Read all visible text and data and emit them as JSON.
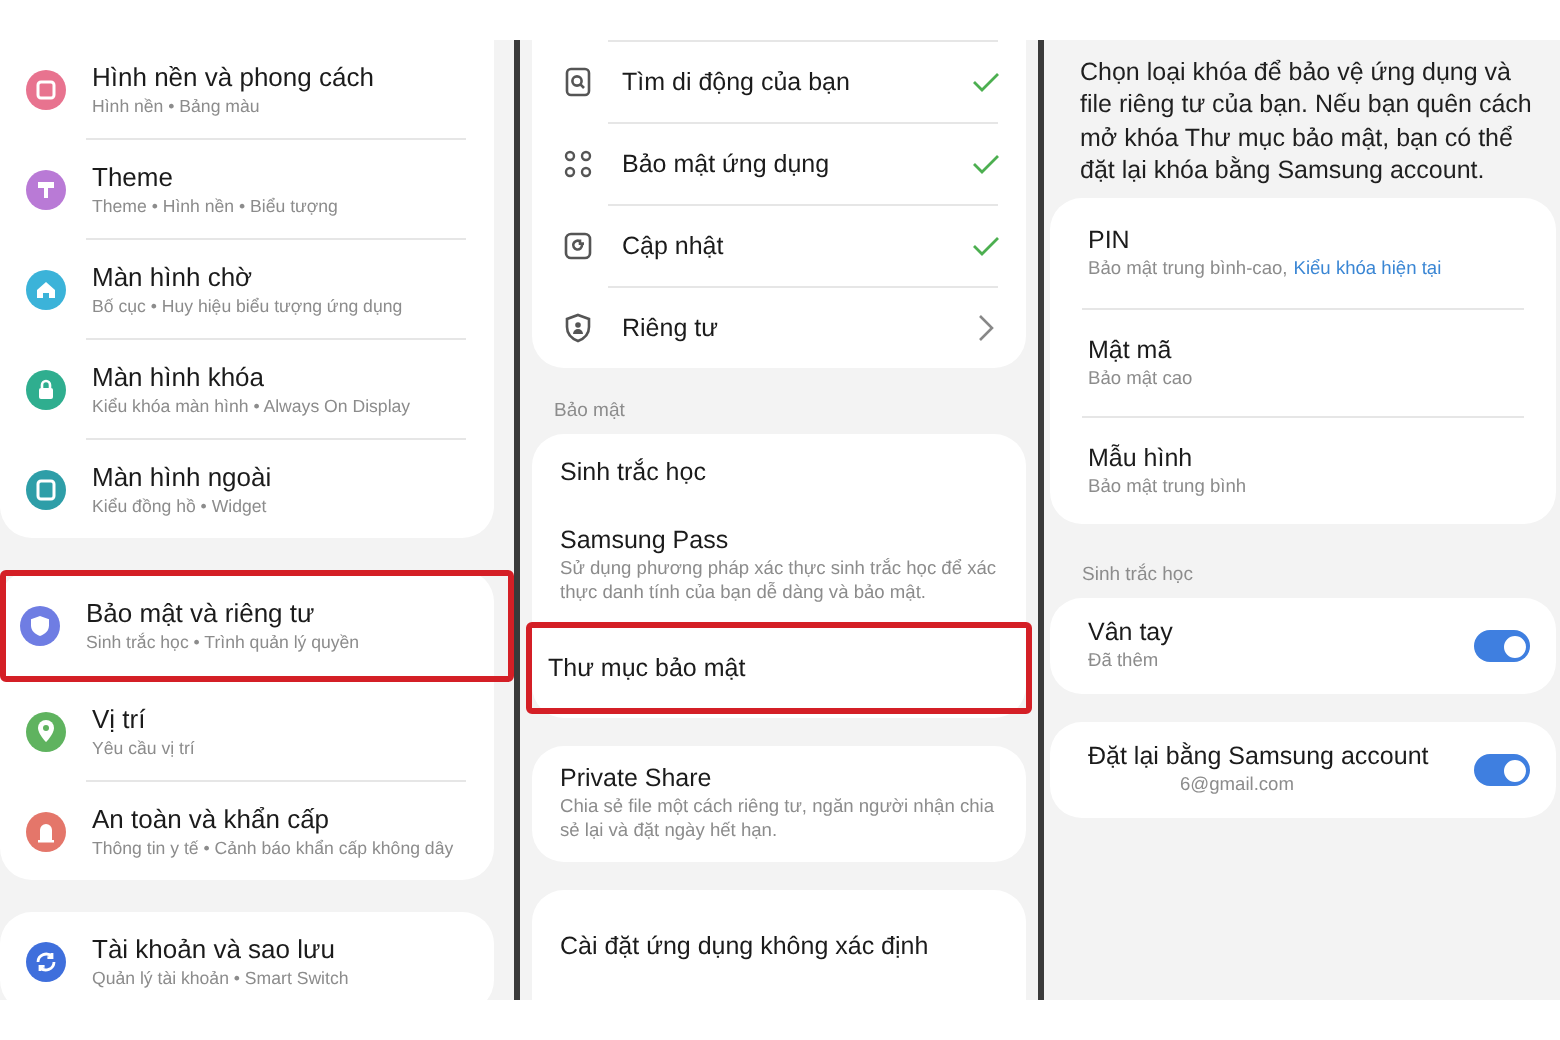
{
  "panels": [
    {
      "kind": "menu",
      "groups": [
        {
          "items": [
            {
              "title": "Hình nền và phong cách",
              "subtitle": "Hình nền • Bảng màu",
              "color": "#e8738f",
              "highlighted": false
            },
            {
              "title": "Theme",
              "subtitle": "Theme • Hình nền • Biểu tượng",
              "color": "#b97ad6",
              "highlighted": false
            },
            {
              "title": "Màn hình chờ",
              "subtitle": "Bố cục • Huy hiệu biểu tượng ứng dụng",
              "color": "#3bb3d9",
              "highlighted": false
            },
            {
              "title": "Màn hình khóa",
              "subtitle": "Kiểu khóa màn hình • Always On Display",
              "color": "#2fae8f",
              "highlighted": false
            },
            {
              "title": "Màn hình ngoài",
              "subtitle": "Kiểu đồng hồ • Widget",
              "color": "#2e9ea8",
              "highlighted": false
            }
          ]
        },
        {
          "items": [
            {
              "title": "Bảo mật và riêng tư",
              "subtitle": "Sinh trắc học • Trình quản lý quyền",
              "color": "#6f7de3",
              "highlighted": true
            },
            {
              "title": "Vị trí",
              "subtitle": "Yêu cầu vị trí",
              "color": "#5fb35f",
              "highlighted": false
            },
            {
              "title": "An toàn và khẩn cấp",
              "subtitle": "Thông tin y tế • Cảnh báo khẩn cấp không dây",
              "color": "#e4766a",
              "highlighted": false
            }
          ]
        },
        {
          "items": [
            {
              "title": "Tài khoản và sao lưu",
              "subtitle": "Quản lý tài khoản • Smart Switch",
              "color": "#3f6fdc",
              "highlighted": false
            }
          ]
        }
      ]
    },
    {
      "kind": "security",
      "groups": [
        {
          "items": [
            {
              "title": "Tìm di động của bạn",
              "kind": "check",
              "highlighted": false
            },
            {
              "title": "Bảo mật ứng dụng",
              "kind": "check",
              "highlighted": false
            },
            {
              "title": "Cập nhật",
              "kind": "check",
              "highlighted": false
            },
            {
              "title": "Riêng tư",
              "kind": "chevron",
              "highlighted": false
            }
          ]
        },
        {
          "header": "Bảo mật",
          "items": [
            {
              "title": "Sinh trắc học",
              "highlighted": false
            },
            {
              "title": "Samsung Pass",
              "subtitle": "Sử dụng phương pháp xác thực sinh trắc học để xác thực danh tính của bạn dễ dàng và bảo mật.",
              "highlighted": false
            },
            {
              "title": "Thư mục bảo mật",
              "highlighted": true
            }
          ]
        },
        {
          "items": [
            {
              "title": "Private Share",
              "subtitle": "Chia sẻ file một cách riêng tư, ngăn người nhận chia sẻ lại và đặt ngày hết hạn.",
              "highlighted": false
            }
          ]
        },
        {
          "items": [
            {
              "title": "Cài đặt ứng dụng không xác định",
              "highlighted": false
            }
          ]
        }
      ]
    },
    {
      "kind": "lock",
      "description": "Chọn loại khóa để bảo vệ ứng dụng và file riêng tư của bạn. Nếu bạn quên cách mở khóa Thư mục bảo mật, bạn có thể đặt lại khóa bằng Samsung account.",
      "groups": [
        {
          "items": [
            {
              "title": "PIN",
              "subtitle": "Bảo mật trung bình-cao,",
              "link": "Kiểu khóa hiện tại"
            },
            {
              "title": "Mật mã",
              "subtitle": "Bảo mật cao"
            },
            {
              "title": "Mẫu hình",
              "subtitle": "Bảo mật trung bình"
            }
          ]
        },
        {
          "header": "Sinh trắc học",
          "items": [
            {
              "title": "Vân tay",
              "subtitle": "Đã thêm",
              "on": true
            }
          ]
        },
        {
          "items": [
            {
              "title": "Đặt lại bằng Samsung account",
              "subtitle": "6@gmail.com",
              "on": true
            }
          ]
        }
      ]
    }
  ]
}
